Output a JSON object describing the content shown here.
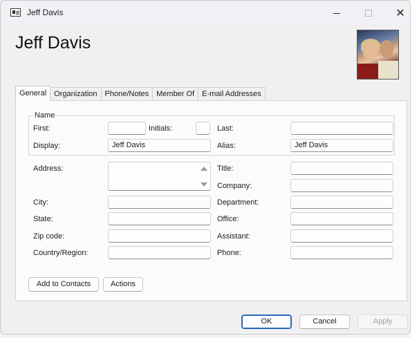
{
  "window": {
    "title": "Jeff Davis"
  },
  "contact_name": "Jeff Davis",
  "tabs": [
    {
      "label": "General"
    },
    {
      "label": "Organization"
    },
    {
      "label": "Phone/Notes"
    },
    {
      "label": "Member Of"
    },
    {
      "label": "E-mail Addresses"
    }
  ],
  "name_group": {
    "legend": "Name",
    "first_label": "First:",
    "first_value": "",
    "initials_label": "Initials:",
    "initials_value": "",
    "last_label": "Last:",
    "last_value": "",
    "display_label": "Display:",
    "display_value": "Jeff Davis",
    "alias_label": "Alias:",
    "alias_value": "Jeff Davis"
  },
  "address": {
    "address_label": "Address:",
    "address_value": "",
    "city_label": "City:",
    "city_value": "",
    "state_label": "State:",
    "state_value": "",
    "zip_label": "Zip code:",
    "zip_value": "",
    "country_label": "Country/Region:",
    "country_value": ""
  },
  "org": {
    "title_label": "Title:",
    "title_value": "",
    "company_label": "Company:",
    "company_value": "",
    "department_label": "Department:",
    "department_value": "",
    "office_label": "Office:",
    "office_value": "",
    "assistant_label": "Assistant:",
    "assistant_value": "",
    "phone_label": "Phone:",
    "phone_value": ""
  },
  "actions": {
    "add_to_contacts": "Add to Contacts",
    "actions": "Actions"
  },
  "footer": {
    "ok": "OK",
    "cancel": "Cancel",
    "apply": "Apply"
  },
  "colors": {
    "accent": "#2768b8",
    "background": "#f0f0f0",
    "panel": "#fbfbfb"
  }
}
